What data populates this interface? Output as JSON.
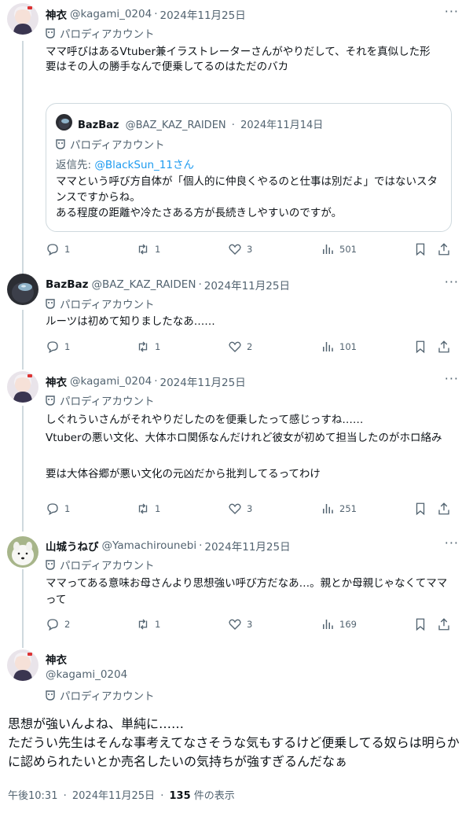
{
  "posts": [
    {
      "name": "神衣",
      "handle": "@kagami_0204",
      "date": "2024年11月25日",
      "badge": "パロディアカウント",
      "text": "ママ呼びはあるVtuber兼イラストレーターさんがやりだして、それを真似した形\n要はその人の勝手なんで便乗してるのはただのバカ",
      "quote": {
        "name": "BazBaz",
        "handle": "@BAZ_KAZ_RAIDEN",
        "date": "2024年11月14日",
        "badge": "パロディアカウント",
        "reply_prefix": "返信先: ",
        "reply_to": "@BlackSun_11さん",
        "text": "ママという呼び方自体が「個人的に仲良くやるのと仕事は別だよ」ではないスタンスですからね。\nある程度の距離や冷たさある方が長続きしやすいのですが。"
      },
      "replies": "1",
      "reposts": "1",
      "likes": "3",
      "views": "501"
    },
    {
      "name": "BazBaz",
      "handle": "@BAZ_KAZ_RAIDEN",
      "date": "2024年11月25日",
      "badge": "パロディアカウント",
      "text": "ルーツは初めて知りましたなあ……",
      "replies": "1",
      "reposts": "1",
      "likes": "2",
      "views": "101"
    },
    {
      "name": "神衣",
      "handle": "@kagami_0204",
      "date": "2024年11月25日",
      "badge": "パロディアカウント",
      "text": "しぐれういさんがそれやりだしたのを便乗したって感じっすね……\nVtuberの悪い文化、大体ホロ関係なんだけれど彼女が初めて担当したのがホロ絡み\n\n要は大体谷郷が悪い文化の元凶だから批判してるってわけ",
      "replies": "1",
      "reposts": "1",
      "likes": "3",
      "views": "251"
    },
    {
      "name": "山城うねび",
      "handle": "@Yamachirounebi",
      "date": "2024年11月25日",
      "badge": "パロディアカウント",
      "text": "ママってある意味お母さんより思想強い呼び方だなあ…。親とか母親じゃなくてママって",
      "replies": "2",
      "reposts": "1",
      "likes": "3",
      "views": "169"
    }
  ],
  "main": {
    "name": "神衣",
    "handle": "@kagami_0204",
    "badge": "パロディアカウント",
    "text": "思想が強いんよね、単純に……\nただうい先生はそんな事考えてなさそうな気もするけど便乗してる奴らは明らかに認められたいとか売名したいの気持ちが強すぎるんだなぁ",
    "time": "午後10:31",
    "date": "2024年11月25日",
    "views_count": "135",
    "views_label": " 件の表示"
  },
  "ui": {
    "sep": "·",
    "more": "···"
  },
  "icons": [
    "more-icon",
    "parody-mask-icon",
    "reply-icon",
    "repost-icon",
    "like-icon",
    "views-icon",
    "bookmark-icon",
    "share-icon"
  ],
  "colors": {
    "text": "#0f1419",
    "muted": "#536471",
    "link": "#1d9bf0",
    "border": "#cfd9de"
  }
}
